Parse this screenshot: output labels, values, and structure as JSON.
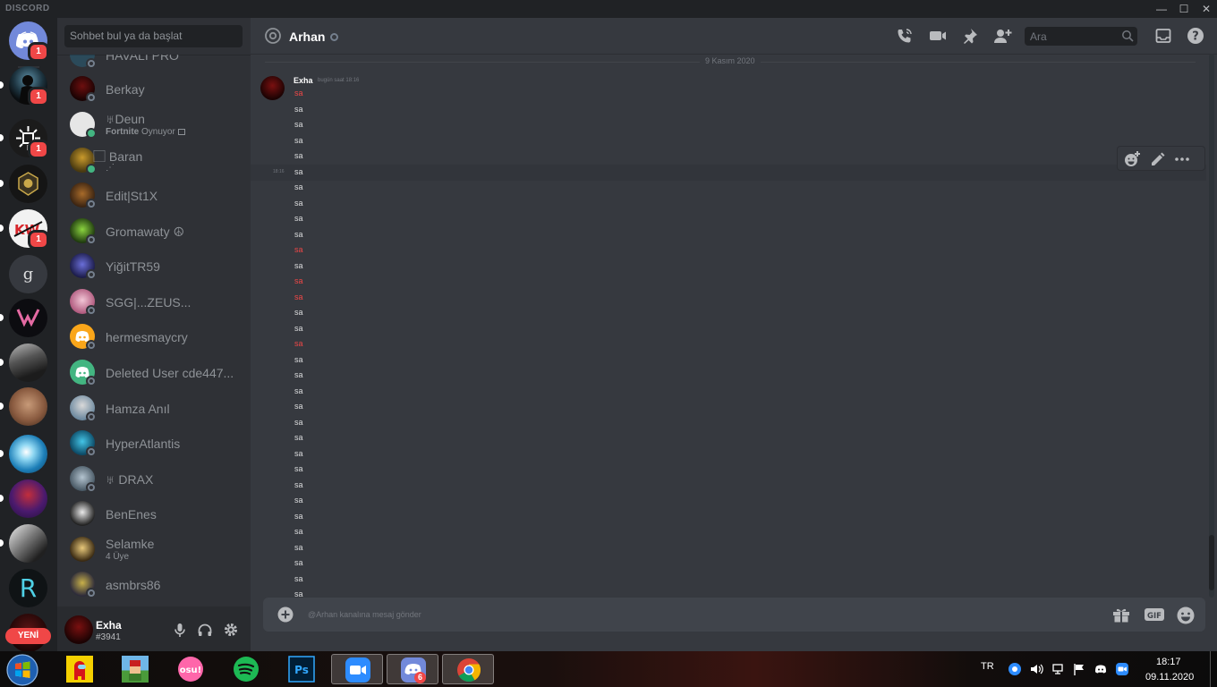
{
  "titlebar": {
    "brand": "DISCORD",
    "min": "—",
    "max": "☐",
    "close": "✕"
  },
  "rail": {
    "home_badge": "1",
    "servers": [
      {
        "badge": "1"
      },
      {
        "badge": "1"
      },
      {
        "badge": ""
      },
      {
        "badge": "1"
      },
      {
        "letter": "g"
      },
      {
        "letter": "R"
      }
    ],
    "new_label": "YENİ"
  },
  "dm_sidebar": {
    "search_placeholder": "Sohbet bul ya da başlat",
    "items": [
      {
        "name": "HAVALI PRO"
      },
      {
        "name": "Berkay"
      },
      {
        "name": "♅Deun",
        "activity_game": "Fortnite",
        "activity_text": "Oynuyor"
      },
      {
        "name": "⃞ Baran",
        "activity_text": "⋰"
      },
      {
        "name": "Edit|St1X"
      },
      {
        "name": "Gromawaty ☮"
      },
      {
        "name": "YiğitTR59"
      },
      {
        "name": "SGG|...ZEUS..."
      },
      {
        "name": "hermesmaycry"
      },
      {
        "name": "Deleted User cde447..."
      },
      {
        "name": "Hamza Anıl"
      },
      {
        "name": "HyperAtlantis"
      },
      {
        "name": "♅ DRAX"
      },
      {
        "name": "BenEnes"
      },
      {
        "name": "Selamke",
        "activity_text": "4 Üye"
      },
      {
        "name": "asmbrs86"
      }
    ],
    "user": {
      "name": "Exha",
      "tag": "#3941"
    }
  },
  "chat": {
    "title": "Arhan",
    "search_placeholder": "Ara",
    "date_separator": "9 Kasım 2020",
    "author": "Exha",
    "timestamp": "bugün saat 18:16",
    "hover_timestamp": "18:16",
    "lines": [
      {
        "text": "sa",
        "red": true
      },
      {
        "text": "sa",
        "red": false
      },
      {
        "text": "sa",
        "red": false
      },
      {
        "text": "sa",
        "red": false
      },
      {
        "text": "sa",
        "red": false
      },
      {
        "text": "sa",
        "red": false
      },
      {
        "text": "sa",
        "red": false
      },
      {
        "text": "sa",
        "red": false
      },
      {
        "text": "sa",
        "red": false
      },
      {
        "text": "sa",
        "red": false
      },
      {
        "text": "sa",
        "red": true
      },
      {
        "text": "sa",
        "red": false
      },
      {
        "text": "sa",
        "red": true
      },
      {
        "text": "sa",
        "red": true
      },
      {
        "text": "sa",
        "red": false
      },
      {
        "text": "sa",
        "red": false
      },
      {
        "text": "sa",
        "red": true
      },
      {
        "text": "sa",
        "red": false
      },
      {
        "text": "sa",
        "red": false
      },
      {
        "text": "sa",
        "red": false
      },
      {
        "text": "sa",
        "red": false
      },
      {
        "text": "sa",
        "red": false
      },
      {
        "text": "sa",
        "red": false
      },
      {
        "text": "sa",
        "red": false
      },
      {
        "text": "sa",
        "red": false
      },
      {
        "text": "sa",
        "red": false
      },
      {
        "text": "sa",
        "red": false
      },
      {
        "text": "sa",
        "red": false
      },
      {
        "text": "sa",
        "red": false
      },
      {
        "text": "sa",
        "red": false
      },
      {
        "text": "sa",
        "red": false
      },
      {
        "text": "sa",
        "red": false
      },
      {
        "text": "sa",
        "red": false
      },
      {
        "text": "sa",
        "red": true
      }
    ],
    "composer_placeholder": "@Arhan kanalına mesaj gönder",
    "gif_label": "GIF"
  },
  "taskbar": {
    "discord_badge": "6",
    "lang": "TR",
    "time": "18:17",
    "date": "09.11.2020"
  },
  "colors": {
    "blurple": "#7289da",
    "red": "#f04747",
    "online": "#43b581"
  }
}
